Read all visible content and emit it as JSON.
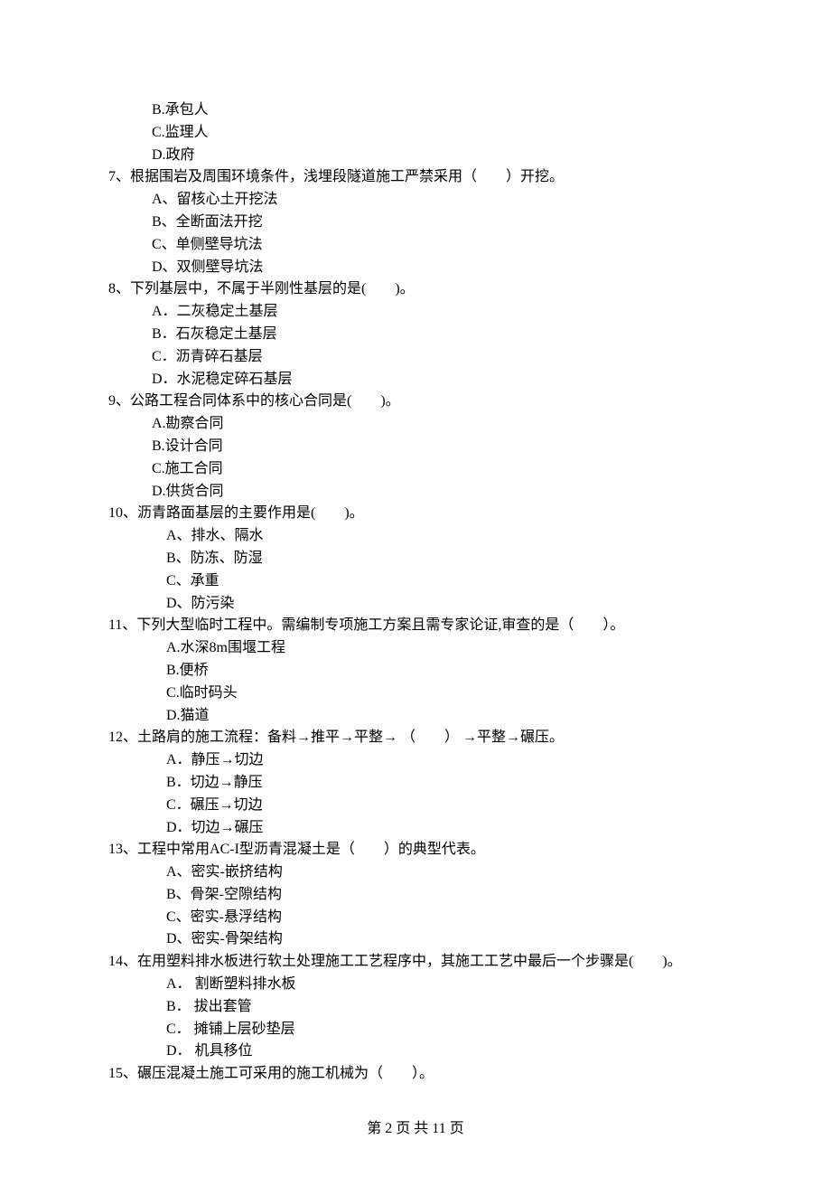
{
  "prefixOptions": [
    "B.承包人",
    "C.监理人",
    "D.政府"
  ],
  "questions": [
    {
      "num": "7、",
      "stem": "根据围岩及周围环境条件，浅埋段隧道施工严禁采用（　　）开挖。",
      "optIndent": 1,
      "options": [
        "A、留核心土开挖法",
        "B、全断面法开挖",
        "C、单侧壁导坑法",
        "D、双侧壁导坑法"
      ]
    },
    {
      "num": "8、",
      "stem": "下列基层中，不属于半刚性基层的是(　　)。",
      "optIndent": 1,
      "options": [
        "A．二灰稳定土基层",
        "B．石灰稳定土基层",
        "C．沥青碎石基层",
        "D．水泥稳定碎石基层"
      ]
    },
    {
      "num": "9、",
      "stem": "公路工程合同体系中的核心合同是(　　)。",
      "optIndent": 1,
      "options": [
        "A.勘察合同",
        "B.设计合同",
        "C.施工合同",
        "D.供货合同"
      ]
    },
    {
      "num": "10、",
      "stem": "沥青路面基层的主要作用是(　　)。",
      "optIndent": 2,
      "options": [
        "A、排水、隔水",
        "B、防冻、防湿",
        "C、承重",
        "D、防污染"
      ]
    },
    {
      "num": "11、",
      "stem": "下列大型临时工程中。需编制专项施工方案且需专家论证,审查的是（　　）。",
      "optIndent": 2,
      "options": [
        "A.水深8m围堰工程",
        "B.便桥",
        "C.临时码头",
        "D.猫道"
      ]
    },
    {
      "num": "12、",
      "stem": "土路肩的施工流程：备料→推平→平整→ （　　） →平整→碾压。",
      "optIndent": 2,
      "options": [
        "A．静压→切边",
        "B．切边→静压",
        "C．碾压→切边",
        "D．切边→碾压"
      ]
    },
    {
      "num": "13、",
      "stem": "工程中常用AC-I型沥青混凝土是（　　）的典型代表。",
      "optIndent": 2,
      "options": [
        "A、密实-嵌挤结构",
        "B、骨架-空隙结构",
        "C、密实-悬浮结构",
        "D、密实-骨架结构"
      ]
    },
    {
      "num": "14、",
      "stem": "在用塑料排水板进行软土处理施工工艺程序中，其施工工艺中最后一个步骤是(　　)。",
      "optIndent": 2,
      "options": [
        "A． 割断塑料排水板",
        "B． 拔出套管",
        "C． 摊铺上层砂垫层",
        "D． 机具移位"
      ]
    },
    {
      "num": "15、",
      "stem": "碾压混凝土施工可采用的施工机械为（　　）。",
      "optIndent": 2,
      "options": []
    }
  ],
  "footer": "第 2 页 共 11 页"
}
